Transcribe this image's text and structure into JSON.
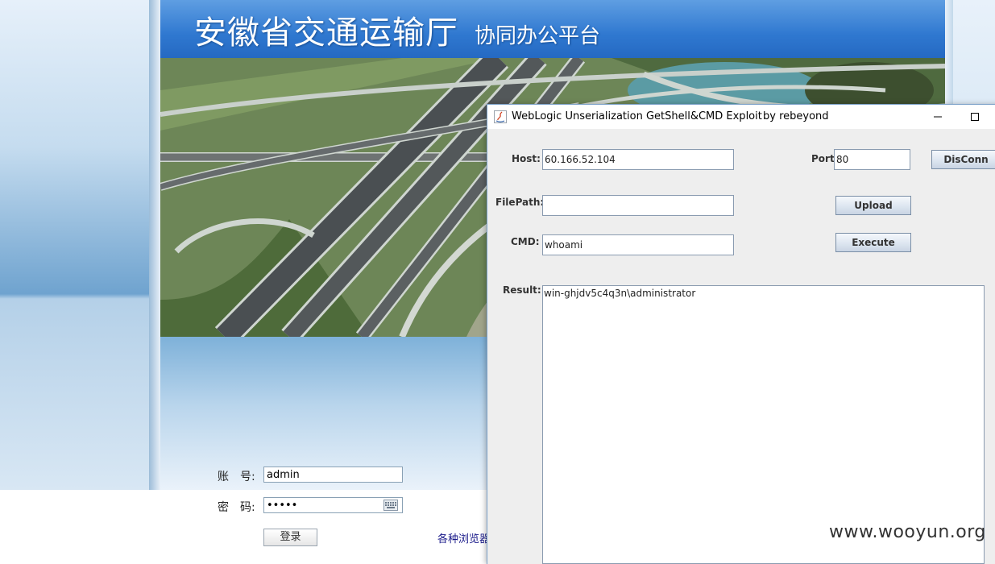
{
  "banner": {
    "title": "安徽省交通运输厅",
    "subtitle": "协同办公平台"
  },
  "login": {
    "account_label": "账　号:",
    "account_value": "admin",
    "password_label": "密　码:",
    "password_value": "•••••",
    "login_button": "登录",
    "browser_link": "各种浏览器",
    "keyboard_icon": "keyboard-icon"
  },
  "exploit_window": {
    "title": "WebLogic Unserialization GetShell&CMD Exploit",
    "author": "by rebeyond",
    "host_label": "Host:",
    "host_value": "60.166.52.104",
    "port_label": "Port:",
    "port_value": "80",
    "disconn_button": "DisConn",
    "filepath_label": "FilePath:",
    "filepath_value": "",
    "upload_button": "Upload",
    "cmd_label": "CMD:",
    "cmd_value": "whoami",
    "execute_button": "Execute",
    "result_label": "Result:",
    "result_text": "win-ghjdv5c4q3n\\administrator",
    "icons": [
      "java-icon",
      "minimize-icon",
      "maximize-icon"
    ]
  },
  "watermark": "www.wooyun.org",
  "colors": {
    "banner_blue": "#2f78d0",
    "window_bg": "#eeeeee",
    "titlebar_bg": "#ffffff"
  }
}
